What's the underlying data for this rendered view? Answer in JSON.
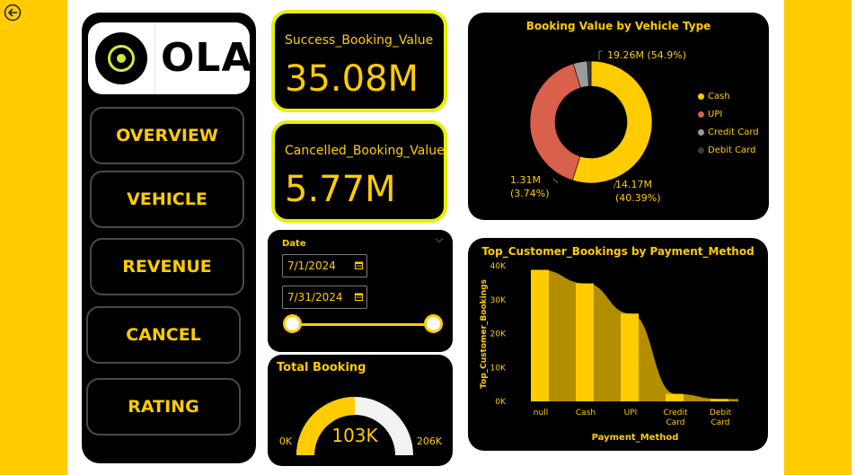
{
  "logo": {
    "text": "OLA"
  },
  "nav": [
    {
      "label": "OVERVIEW"
    },
    {
      "label": "VEHICLE"
    },
    {
      "label": "REVENUE"
    },
    {
      "label": "CANCEL"
    },
    {
      "label": "RATING"
    }
  ],
  "kpis": {
    "success": {
      "label": "Success_Booking_Value",
      "value": "35.08M"
    },
    "cancelled": {
      "label": "Cancelled_Booking_Value",
      "value": "5.77M"
    }
  },
  "date_filter": {
    "label": "Date",
    "start": "7/1/2024",
    "end": "7/31/2024"
  },
  "gauge": {
    "title": "Total Booking",
    "value_label": "103K",
    "min_label": "0K",
    "max_label": "206K",
    "fraction": 0.5
  },
  "colors": {
    "accent": "#FFCC00",
    "kpi_border": "#e6f000",
    "upi": "#D9604A",
    "credit": "#9B9B9B",
    "debit": "#3A3A3A"
  },
  "chart_data": [
    {
      "type": "pie",
      "title": "Booking Value by Vehicle Type",
      "series": [
        {
          "name": "Cash",
          "value": 19.26,
          "label": "19.26M (54.9%)",
          "percent": 54.9
        },
        {
          "name": "UPI",
          "value": 14.17,
          "label_line1": "14.17M",
          "label_line2": "(40.39%)",
          "percent": 40.39
        },
        {
          "name": "Credit Card",
          "value": 1.31,
          "label_line1": "1.31M",
          "label_line2": "(3.74%)",
          "percent": 3.74
        },
        {
          "name": "Debit Card",
          "value": 0.34,
          "percent": 0.97
        }
      ],
      "legend_position": "right"
    },
    {
      "type": "area",
      "title": "Top_Customer_Bookings by Payment_Method",
      "xlabel": "Payment_Method",
      "ylabel": "Top_Customer_Bookings",
      "categories": [
        "null",
        "Cash",
        "UPI",
        "Credit Card",
        "Debit Card"
      ],
      "category_lines": [
        [
          "null"
        ],
        [
          "Cash"
        ],
        [
          "UPI"
        ],
        [
          "Credit",
          "Card"
        ],
        [
          "Debit",
          "Card"
        ]
      ],
      "values": [
        38800,
        34800,
        25900,
        2200,
        700
      ],
      "ylim": [
        0,
        40000
      ],
      "yticks": [
        0,
        10000,
        20000,
        30000,
        40000
      ],
      "ytick_labels": [
        "0K",
        "10K",
        "20K",
        "30K",
        "40K"
      ]
    }
  ]
}
